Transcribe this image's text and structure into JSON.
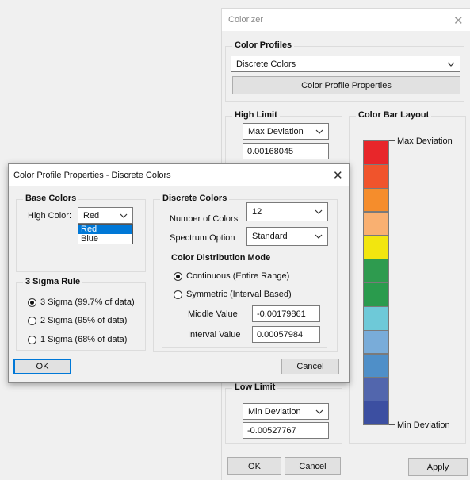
{
  "colorizer": {
    "title": "Colorizer",
    "profiles_group": "Color Profiles",
    "profile_selected": "Discrete Colors",
    "profile_props_btn": "Color Profile Properties",
    "high_limit_group": "High Limit",
    "high_limit_mode": "Max Deviation",
    "high_limit_value": "0.00168045",
    "colorbar_group": "Color Bar Layout",
    "colorbar_top_label": "Max Deviation",
    "colorbar_bottom_label": "Min Deviation",
    "colorbar_colors": [
      "#e8262a",
      "#f0542c",
      "#f58d2c",
      "#f9b071",
      "#f2e60f",
      "#2e9b4f",
      "#2a9b4d",
      "#6ec9d8",
      "#79acd9",
      "#4f8fc8",
      "#5266ad",
      "#3c4fa1"
    ],
    "low_limit_group": "Low Limit",
    "low_limit_mode": "Min Deviation",
    "low_limit_value": "-0.00527767",
    "ok": "OK",
    "cancel": "Cancel",
    "apply": "Apply"
  },
  "dialog": {
    "title": "Color Profile Properties - Discrete Colors",
    "base_colors_group": "Base Colors",
    "high_color_label": "High Color:",
    "high_color_value": "Red",
    "high_color_options": [
      "Red",
      "Blue"
    ],
    "sigma_group": "3 Sigma Rule",
    "sigma_options": [
      "3 Sigma (99.7% of data)",
      "2 Sigma (95% of data)",
      "1 Sigma (68% of data)"
    ],
    "sigma_selected": 0,
    "discrete_group": "Discrete Colors",
    "num_colors_label": "Number of Colors",
    "num_colors_value": "12",
    "spectrum_label": "Spectrum Option",
    "spectrum_value": "Standard",
    "distribution_group": "Color Distribution Mode",
    "dist_continuous": "Continuous (Entire Range)",
    "dist_symmetric": "Symmetric  (Interval Based)",
    "middle_label": "Middle Value",
    "middle_value": "-0.00179861",
    "interval_label": "Interval Value",
    "interval_value": "0.00057984",
    "ok": "OK",
    "cancel": "Cancel"
  }
}
